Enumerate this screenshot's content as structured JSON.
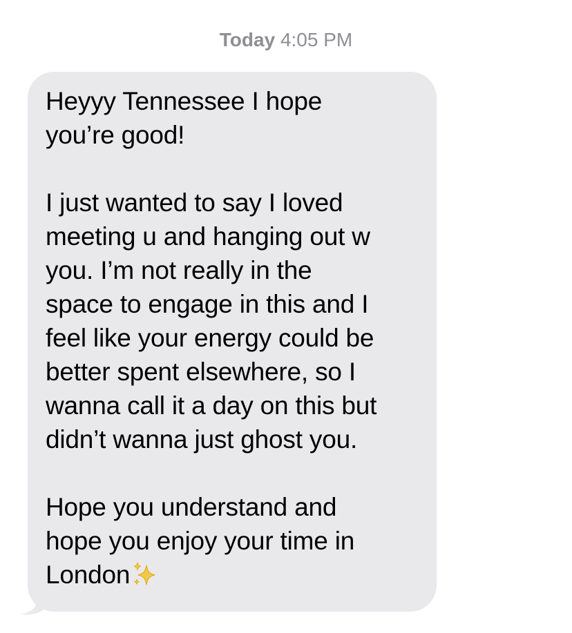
{
  "timestamp": {
    "day": "Today",
    "time": "4:05 PM"
  },
  "message": {
    "sender": "incoming",
    "paragraphs": [
      "Heyyy Tennessee I hope\nyou’re good!",
      "I just wanted to say I loved\nmeeting u and hanging out w\nyou. I’m not really in the\nspace to engage in this and I\nfeel like your energy could be\nbetter spent elsewhere, so I\nwanna call it a day on this but\ndidn’t wanna just ghost you.",
      "Hope you understand and\nhope you enjoy your time in\nLondon"
    ],
    "emoji": "sparkles-icon"
  },
  "colors": {
    "bubble": "#e9e9eb",
    "timestamp": "#8e8e93",
    "text": "#000000",
    "sparkles": "#f2c94c"
  }
}
